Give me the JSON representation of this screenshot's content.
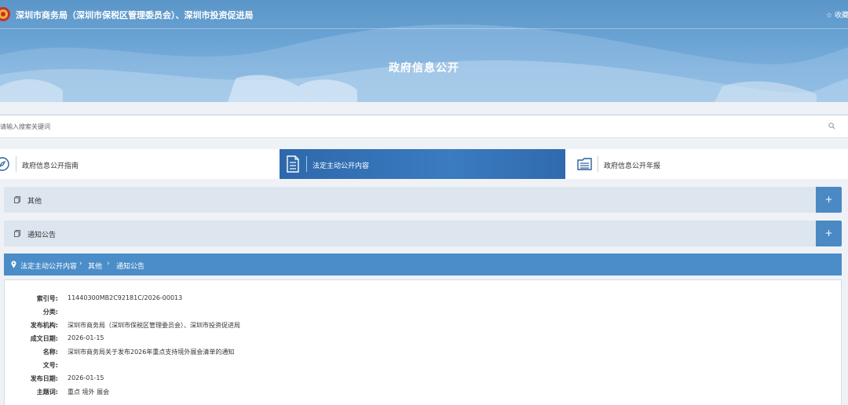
{
  "header": {
    "site_title": "深圳市商务局（深圳市保税区管理委员会）、深圳市投资促进局",
    "favorite_label": "☆ 收藏",
    "banner_title": "政府信息公开"
  },
  "search": {
    "placeholder": "请输入搜索关键词"
  },
  "tabs": [
    {
      "label": "政府信息公开指南",
      "icon": "compass-icon",
      "active": false
    },
    {
      "label": "法定主动公开内容",
      "icon": "document-list-icon",
      "active": true
    },
    {
      "label": "政府信息公开年报",
      "icon": "folder-icon",
      "active": false
    }
  ],
  "accordions": [
    {
      "label": "其他",
      "toggle": "+"
    },
    {
      "label": "通知公告",
      "toggle": "+"
    }
  ],
  "breadcrumb": {
    "items": [
      "法定主动公开内容",
      "其他",
      "通知公告"
    ],
    "separator": "›"
  },
  "detail": {
    "fields": [
      {
        "label": "索引号:",
        "value": "11440300MB2C92181C/2026-00013"
      },
      {
        "label": "分类:",
        "value": ""
      },
      {
        "label": "发布机构:",
        "value": "深圳市商务局（深圳市保税区管理委员会）、深圳市投资促进局"
      },
      {
        "label": "成文日期:",
        "value": "2026-01-15"
      },
      {
        "label": "名称:",
        "value": "深圳市商务局关于发布2026年重点支持境外展会清单的通知"
      },
      {
        "label": "文号:",
        "value": ""
      },
      {
        "label": "发布日期:",
        "value": "2026-01-15"
      },
      {
        "label": "主题词:",
        "value": "重点 境外 展会"
      }
    ]
  },
  "colors": {
    "banner": "#6aa3d4",
    "tab_active": "#3b7bc0",
    "accordion_bg": "#dde6ee",
    "accordion_toggle": "#4a89c4",
    "breadcrumb_bar": "#4a8dc8"
  }
}
